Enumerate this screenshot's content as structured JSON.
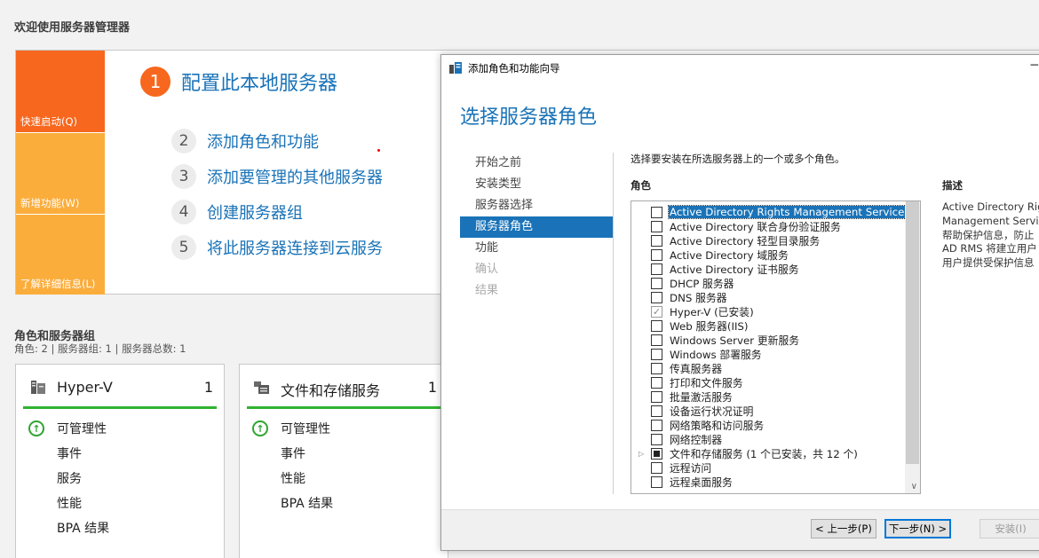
{
  "welcome": {
    "title": "欢迎使用服务器管理器",
    "tiles": {
      "quick_start": "快速启动(Q)",
      "whats_new": "新增功能(W)",
      "learn_more": "了解详细信息(L)"
    },
    "steps": [
      {
        "num": "1",
        "label": "配置此本地服务器"
      },
      {
        "num": "2",
        "label": "添加角色和功能"
      },
      {
        "num": "3",
        "label": "添加要管理的其他服务器"
      },
      {
        "num": "4",
        "label": "创建服务器组"
      },
      {
        "num": "5",
        "label": "将此服务器连接到云服务"
      }
    ]
  },
  "roles_groups": {
    "title": "角色和服务器组",
    "summary": "角色: 2 | 服务器组: 1 | 服务器总数: 1",
    "cards": [
      {
        "name": "Hyper-V",
        "count": "1",
        "items": [
          "可管理性",
          "事件",
          "服务",
          "性能",
          "BPA 结果"
        ]
      },
      {
        "name": "文件和存储服务",
        "count": "1",
        "items": [
          "可管理性",
          "事件",
          "性能",
          "BPA 结果"
        ]
      }
    ]
  },
  "wizard": {
    "window_title": "添加角色和功能向导",
    "close": "─",
    "heading": "选择服务器角色",
    "nav": [
      "开始之前",
      "安装类型",
      "服务器选择",
      "服务器角色",
      "功能",
      "确认",
      "结果"
    ],
    "instruction": "选择要安装在所选服务器上的一个或多个角色。",
    "roles_label": "角色",
    "description_label": "描述",
    "description_lines": [
      "Active Directory Rig",
      "Management Servic",
      "帮助保护信息，防止",
      "AD RMS 将建立用户",
      "用户提供受保护信息"
    ],
    "roles": [
      {
        "label": "Active Directory Rights Management Services",
        "state": "unchecked",
        "selected": true
      },
      {
        "label": "Active Directory 联合身份验证服务",
        "state": "unchecked"
      },
      {
        "label": "Active Directory 轻型目录服务",
        "state": "unchecked"
      },
      {
        "label": "Active Directory 域服务",
        "state": "unchecked"
      },
      {
        "label": "Active Directory 证书服务",
        "state": "unchecked"
      },
      {
        "label": "DHCP 服务器",
        "state": "unchecked"
      },
      {
        "label": "DNS 服务器",
        "state": "unchecked"
      },
      {
        "label": "Hyper-V (已安装)",
        "state": "checked"
      },
      {
        "label": "Web 服务器(IIS)",
        "state": "unchecked"
      },
      {
        "label": "Windows Server 更新服务",
        "state": "unchecked"
      },
      {
        "label": "Windows 部署服务",
        "state": "unchecked"
      },
      {
        "label": "传真服务器",
        "state": "unchecked"
      },
      {
        "label": "打印和文件服务",
        "state": "unchecked"
      },
      {
        "label": "批量激活服务",
        "state": "unchecked"
      },
      {
        "label": "设备运行状况证明",
        "state": "unchecked"
      },
      {
        "label": "网络策略和访问服务",
        "state": "unchecked"
      },
      {
        "label": "网络控制器",
        "state": "unchecked"
      },
      {
        "label": "文件和存储服务 (1 个已安装，共 12 个)",
        "state": "partial",
        "expandable": true
      },
      {
        "label": "远程访问",
        "state": "unchecked"
      },
      {
        "label": "远程桌面服务",
        "state": "unchecked"
      }
    ],
    "buttons": {
      "back": "< 上一步(P)",
      "next": "下一步(N) >",
      "install": "安装(I)"
    }
  }
}
